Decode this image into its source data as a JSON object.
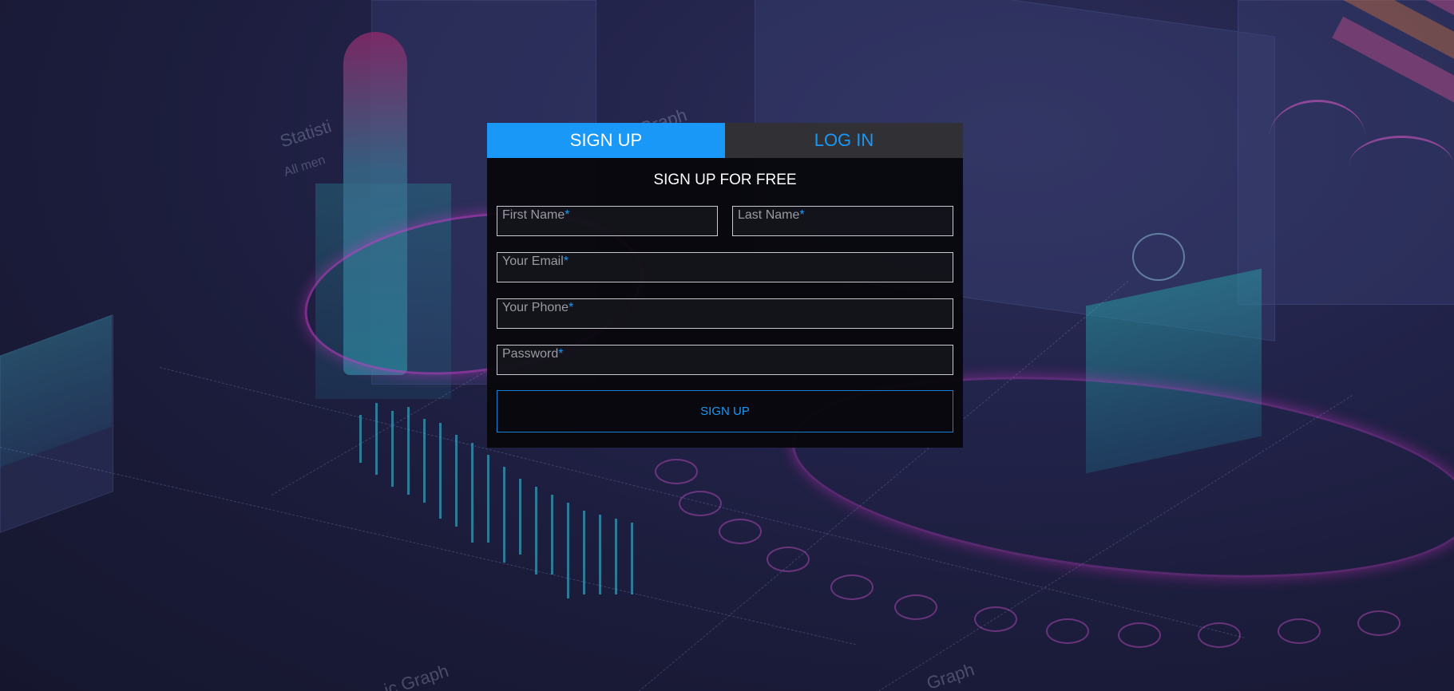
{
  "tabs": {
    "signup": "SIGN UP",
    "login": "LOG IN"
  },
  "form": {
    "title": "SIGN UP FOR FREE",
    "required_marker": "*",
    "fields": {
      "first_name": "First Name",
      "last_name": "Last Name",
      "email": "Your Email",
      "phone": "Your Phone",
      "password": "Password"
    },
    "submit_label": "SIGN UP"
  },
  "background": {
    "texts": [
      "Statisti",
      "Graph",
      "All men",
      "ic Graph",
      "Graph"
    ]
  },
  "colors": {
    "accent": "#1a98f7",
    "tab_inactive_bg": "#313135",
    "card_bg": "#06060a"
  }
}
